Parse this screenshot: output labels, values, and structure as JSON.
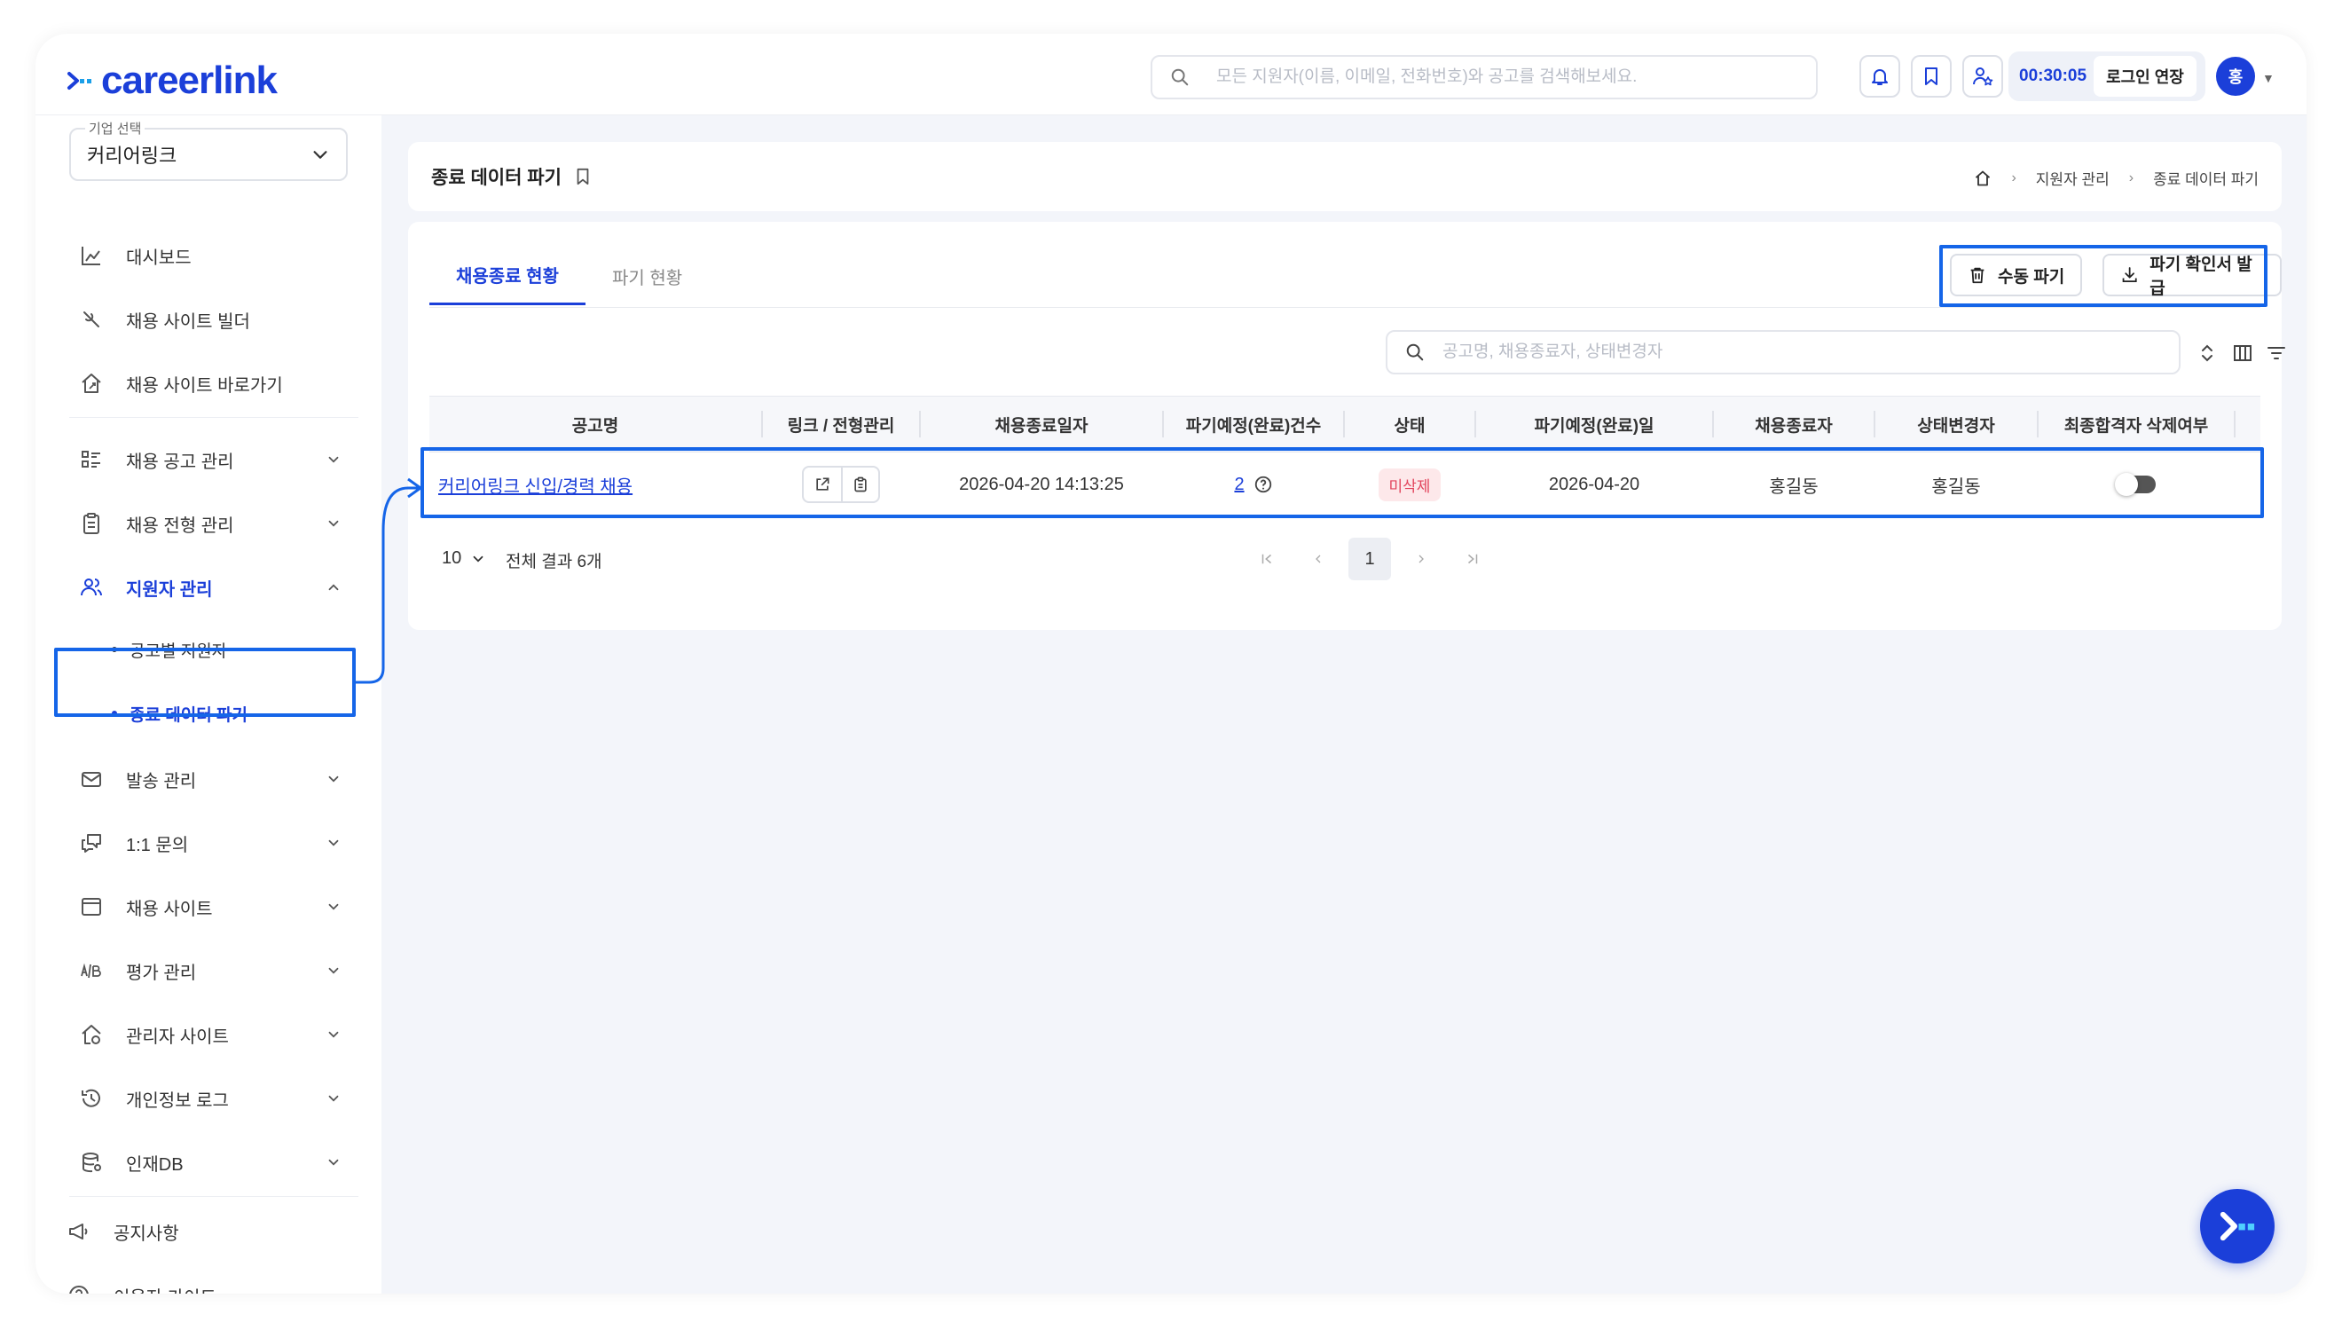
{
  "header": {
    "logo_text": "careerlink",
    "search_placeholder": "모든 지원자(이름, 이메일, 전화번호)와 공고를 검색해보세요.",
    "timer": "00:30:05",
    "extend_label": "로그인 연장",
    "avatar_initial": "홍"
  },
  "sidebar": {
    "company_label": "기업 선택",
    "company_value": "커리어링크",
    "items": [
      {
        "label": "대시보드",
        "icon": "chart-icon"
      },
      {
        "label": "채용 사이트 빌더",
        "icon": "tools-icon"
      },
      {
        "label": "채용 사이트 바로가기",
        "icon": "home-link-icon"
      },
      {
        "label": "채용 공고 관리",
        "icon": "list-icon"
      },
      {
        "label": "채용 전형 관리",
        "icon": "clipboard-icon"
      },
      {
        "label": "지원자 관리",
        "icon": "users-icon"
      },
      {
        "label": "발송 관리",
        "icon": "mail-icon"
      },
      {
        "label": "1:1 문의",
        "icon": "chat-icon"
      },
      {
        "label": "채용 사이트",
        "icon": "browser-icon"
      },
      {
        "label": "평가 관리",
        "icon": "ab-icon"
      },
      {
        "label": "관리자 사이트",
        "icon": "admin-home-icon"
      },
      {
        "label": "개인정보 로그",
        "icon": "history-icon"
      },
      {
        "label": "인재DB",
        "icon": "database-icon"
      }
    ],
    "sub_items": [
      {
        "label": "공고별 지원자"
      },
      {
        "label": "종료 데이터 파기"
      }
    ],
    "bottom": [
      {
        "label": "공지사항",
        "icon": "megaphone-icon"
      },
      {
        "label": "이용자 가이드",
        "icon": "help-icon"
      }
    ]
  },
  "page": {
    "title": "종료 데이터 파기",
    "breadcrumb": [
      "지원자 관리",
      "종료 데이터 파기"
    ]
  },
  "tabs": [
    {
      "label": "채용종료 현황"
    },
    {
      "label": "파기 현황"
    }
  ],
  "actions": {
    "manual_delete": "수동 파기",
    "certificate": "파기 확인서 발급"
  },
  "table": {
    "search_placeholder": "공고명, 채용종료자, 상태변경자",
    "columns": [
      "공고명",
      "링크 / 전형관리",
      "채용종료일자",
      "파기예정(완료)건수",
      "상태",
      "파기예정(완료)일",
      "채용종료자",
      "상태변경자",
      "최종합격자 삭제여부"
    ],
    "rows": [
      {
        "job": "커리어링크 신입/경력 채용",
        "end_date": "2026-04-20 14:13:25",
        "count": "2",
        "status": "미삭제",
        "scheduled_date": "2026-04-20",
        "closer": "홍길동",
        "changer": "홍길동"
      }
    ],
    "page_size": "10",
    "total": "전체 결과 6개",
    "current_page": "1"
  },
  "colors": {
    "brand": "#1b3fd9",
    "highlight": "#1565e8",
    "status_red": "#e2445c"
  }
}
